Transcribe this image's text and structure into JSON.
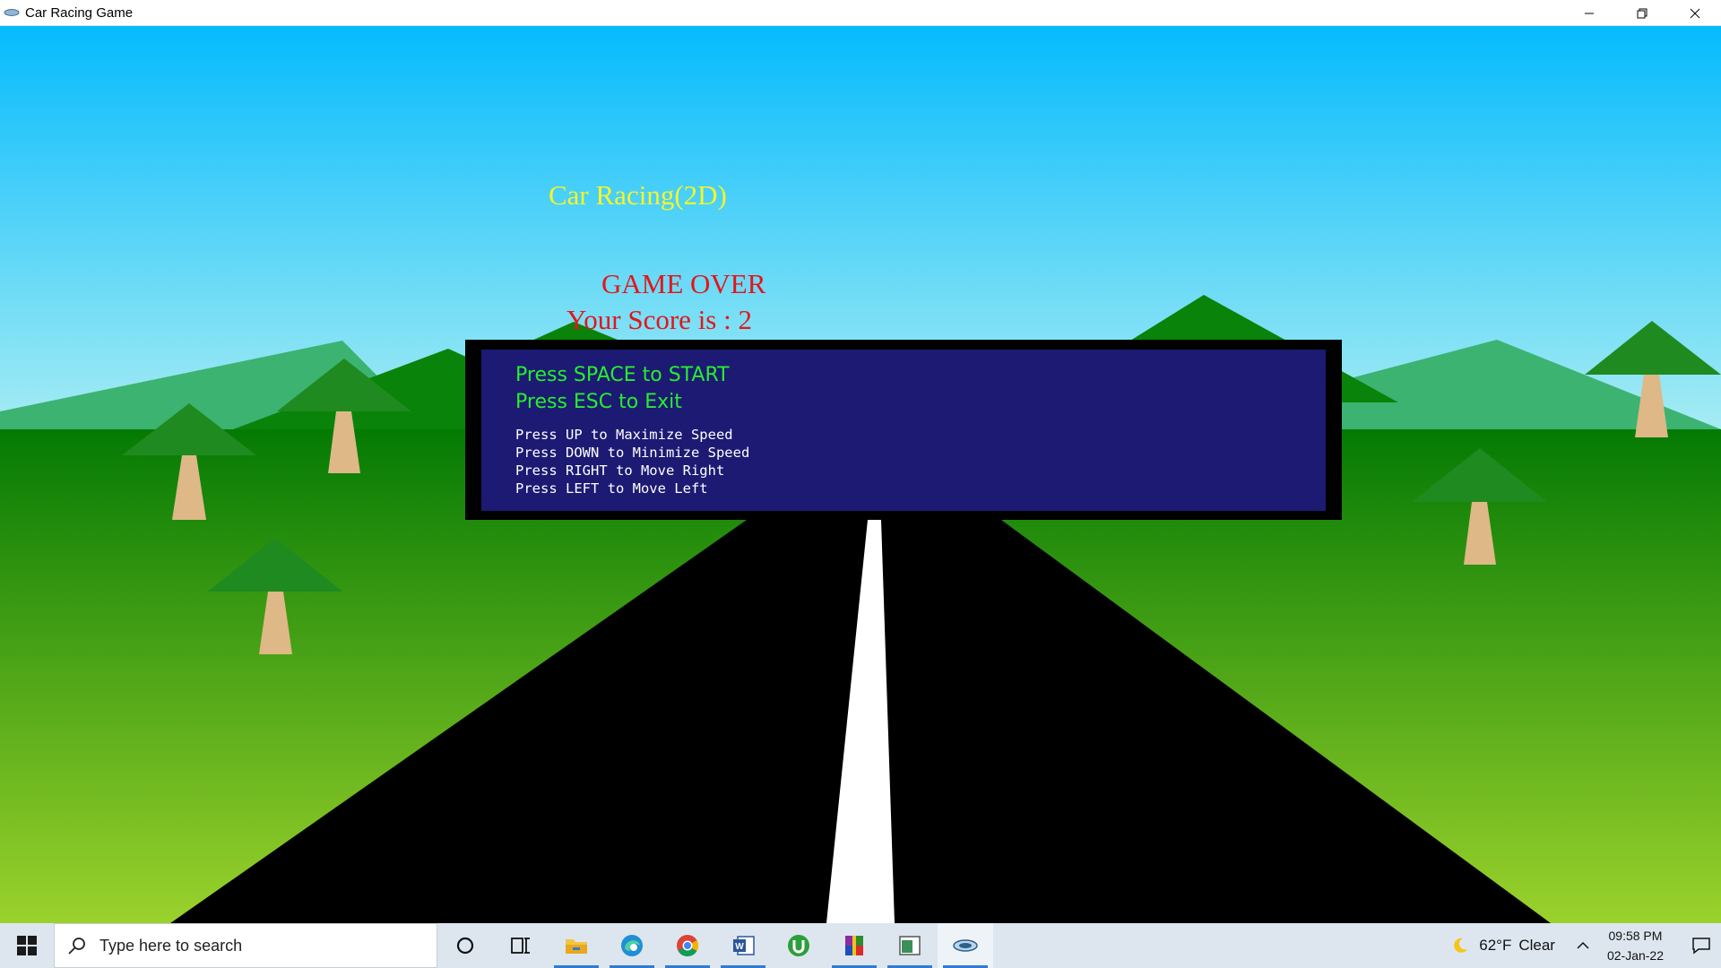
{
  "window": {
    "title": "Car Racing Game",
    "controls": [
      "minimize-icon",
      "restore-icon",
      "close-icon"
    ]
  },
  "game": {
    "title": "Car Racing(2D)",
    "status": "GAME OVER",
    "score_text": "Your Score is : 2",
    "score": 2,
    "menu": {
      "start": "Press SPACE to START",
      "exit": "Press ESC to Exit",
      "controls": [
        "Press UP to Maximize Speed",
        "Press DOWN to Minimize Speed",
        "Press RIGHT to Move Right",
        "Press LEFT to Move Left"
      ]
    },
    "colors": {
      "sky_top": "#05bbfd",
      "sky_bottom": "#a6ecf3",
      "grass_top": "#047a04",
      "grass_bottom": "#9bd22c",
      "road": "#000000",
      "lane": "#ffffff",
      "title": "#f5f52a",
      "gameover": "#e3161b",
      "panel_bg": "#1c1a73",
      "menu_green": "#27ee2d"
    }
  },
  "taskbar": {
    "search_placeholder": "Type here to search",
    "icons": [
      "windows-start-icon",
      "cortana-icon",
      "task-view-icon",
      "file-explorer-icon",
      "edge-icon",
      "chrome-icon",
      "word-icon",
      "utorrent-icon",
      "winrar-icon",
      "app-icon",
      "game-app-icon"
    ],
    "weather": {
      "temperature": "62°F",
      "condition": "Clear"
    },
    "time": "09:58 PM",
    "date": "02-Jan-22"
  }
}
